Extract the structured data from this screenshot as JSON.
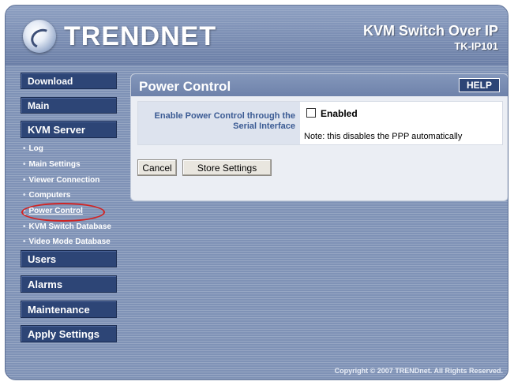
{
  "header": {
    "brand": "TRENDNET",
    "product_title": "KVM Switch Over IP",
    "model": "TK-IP101"
  },
  "sidebar": {
    "top_items": [
      {
        "label": "Download"
      },
      {
        "label": "Main"
      },
      {
        "label": "KVM Server"
      }
    ],
    "kvm_sub_items": [
      {
        "label": "Log"
      },
      {
        "label": "Main Settings"
      },
      {
        "label": "Viewer Connection"
      },
      {
        "label": "Computers"
      },
      {
        "label": "Power Control",
        "active": true
      },
      {
        "label": "KVM Switch Database"
      },
      {
        "label": "Video Mode Database"
      }
    ],
    "bottom_items": [
      {
        "label": "Users"
      },
      {
        "label": "Alarms"
      },
      {
        "label": "Maintenance"
      },
      {
        "label": "Apply Settings"
      }
    ]
  },
  "panel": {
    "title": "Power Control",
    "help_label": "HELP",
    "setting_label_line1": "Enable Power Control through the",
    "setting_label_line2": "Serial Interface",
    "checkbox_label": "Enabled",
    "checkbox_checked": false,
    "note": "Note: this disables the PPP automatically",
    "cancel_label": "Cancel",
    "store_label": "Store Settings"
  },
  "footer": {
    "copyright": "Copyright © 2007 TRENDnet. All Rights Reserved."
  },
  "colors": {
    "nav_button": "#2d4576",
    "background": "#7f92b6",
    "highlight_circle": "#d02424",
    "label_text": "#3a5a93"
  },
  "icons": {
    "logo": "trendnet-logo-icon",
    "checkbox": "checkbox-unchecked-icon"
  }
}
